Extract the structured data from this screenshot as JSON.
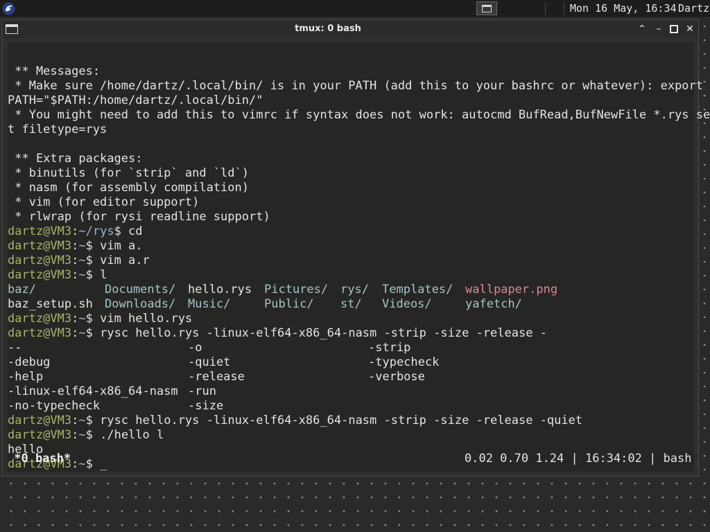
{
  "topbar": {
    "clock": "Mon 16 May, 16:34",
    "user": "Dartz"
  },
  "window": {
    "title": "tmux: 0 bash"
  },
  "terminal": {
    "messages_header": " ** Messages:",
    "msg1": " * Make sure /home/dartz/.local/bin/ is in your PATH (add this to your bashrc or whatever): export",
    "msg1b": "PATH=\"$PATH:/home/dartz/.local/bin/\"",
    "msg2": " * You might need to add this to vimrc if syntax does not work: autocmd BufRead,BufNewFile *.rys se",
    "msg2b": "t filetype=rys",
    "extra_header": " ** Extra packages:",
    "pkg1": " * binutils (for `strip` and `ld`)",
    "pkg2": " * nasm (for assembly compilation)",
    "pkg3": " * vim (for editor support)",
    "pkg4": " * rlwrap (for rysi readline support)",
    "prompt_user": "dartz@VM3",
    "prompt_dir_rys": "~/rys",
    "prompt_dir_home": "~",
    "cmd1": " cd",
    "cmd2": " vim a.",
    "cmd3": " vim a.r",
    "cmd4": " l",
    "ls": {
      "r1c1": "baz/",
      "r1c2": "Documents/",
      "r1c3": "hello.rys",
      "r1c4": "Pictures/",
      "r1c5": "rys/",
      "r1c6": "Templates/",
      "r1c7": "wallpaper.png",
      "r2c1": "baz_setup.sh",
      "r2c2": "Downloads/",
      "r2c3": "Music/",
      "r2c4": "Public/",
      "r2c5": "st/",
      "r2c6": "Videos/",
      "r2c7": "yafetch/"
    },
    "cmd5": " vim hello.rys",
    "cmd6": " rysc hello.rys -linux-elf64-x86_64-nasm -strip -size -release -",
    "comp": {
      "c1r1": "--",
      "c2r1": "-o",
      "c3r1": "-strip",
      "c1r2": "-debug",
      "c2r2": "-quiet",
      "c3r2": "-typecheck",
      "c1r3": "-help",
      "c2r3": "-release",
      "c3r3": "-verbose",
      "c1r4": "-linux-elf64-x86_64-nasm",
      "c2r4": "-run",
      "c1r5": "-no-typecheck",
      "c2r5": "-size"
    },
    "cmd7": " rysc hello.rys -linux-elf64-x86_64-nasm -strip -size -release -quiet",
    "cmd8": " ./hello l",
    "out_hello": "hello",
    "cursor": " _"
  },
  "tmux_status": {
    "window_list": " *0 bash*",
    "right": "0.02 0.70 1.24 | 16:34:02 | bash"
  },
  "colors": {
    "prompt_user": "#a9b56a",
    "prompt_dir": "#9fb6c8",
    "directory": "#a6c4c7",
    "image_file": "#d88a98"
  }
}
